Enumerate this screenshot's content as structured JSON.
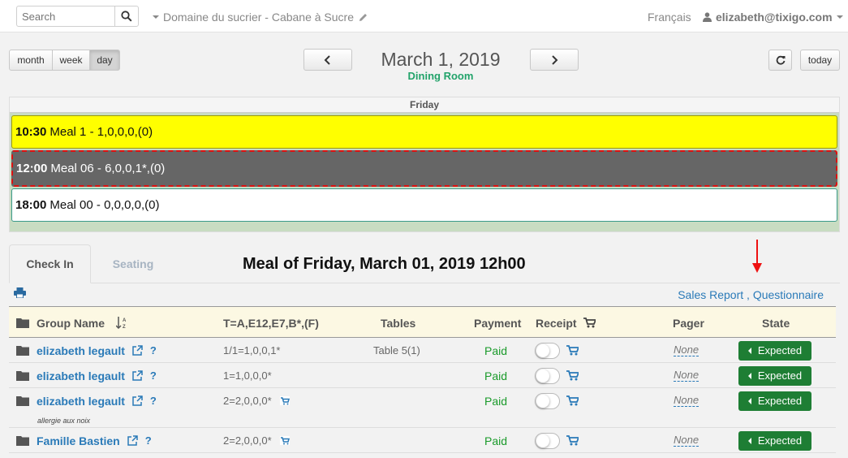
{
  "topbar": {
    "search_placeholder": "Search",
    "venue": "Domaine du sucrier - Cabane à Sucre",
    "language": "Français",
    "user": "elizabeth@tixigo.com"
  },
  "toolbar": {
    "views": [
      "month",
      "week",
      "day"
    ],
    "active_view": "day",
    "date_title": "March 1, 2019",
    "room": "Dining Room",
    "today_label": "today"
  },
  "calendar": {
    "day_header": "Friday",
    "events": [
      {
        "time": "10:30",
        "label": "Meal 1 - 1,0,0,0,(0)",
        "color": "#ffff00"
      },
      {
        "time": "12:00",
        "label": "Meal 06 - 6,0,0,1*,(0)",
        "color": "#666666",
        "selected": true
      },
      {
        "time": "18:00",
        "label": "Meal 00 - 0,0,0,0,(0)",
        "color": "#ffffff"
      }
    ]
  },
  "tabs": {
    "check_in": "Check In",
    "seating": "Seating"
  },
  "meal_title": "Meal of Friday, March 01, 2019 12h00",
  "reports": {
    "sales": "Sales Report",
    "separator": " , ",
    "questionnaire": "Questionnaire"
  },
  "table": {
    "headers": {
      "group_name": "Group Name",
      "composition": "T=A,E12,E7,B*,(F)",
      "tables": "Tables",
      "payment": "Payment",
      "receipt": "Receipt",
      "pager": "Pager",
      "state": "State"
    },
    "rows": [
      {
        "name": "elizabeth legault",
        "composition": "1/1=1,0,0,1*",
        "table": "Table 5(1)",
        "payment": "Paid",
        "pager": "None",
        "state": "Expected",
        "note": "",
        "cart_flag": false
      },
      {
        "name": "elizabeth legault",
        "composition": "1=1,0,0,0*",
        "table": "",
        "payment": "Paid",
        "pager": "None",
        "state": "Expected",
        "note": "",
        "cart_flag": false
      },
      {
        "name": "elizabeth legault",
        "composition": "2=2,0,0,0*",
        "table": "",
        "payment": "Paid",
        "pager": "None",
        "state": "Expected",
        "note": "allergie aux noix",
        "cart_flag": true
      },
      {
        "name": "Famille Bastien",
        "composition": "2=2,0,0,0*",
        "table": "",
        "payment": "Paid",
        "pager": "None",
        "state": "Expected",
        "note": "",
        "cart_flag": true
      }
    ]
  },
  "colors": {
    "accent": "#2a7ab8",
    "paid": "#1a9a2a",
    "state": "#1e7e34",
    "room": "#22a36a",
    "highlight_arrow": "#ee1111"
  }
}
